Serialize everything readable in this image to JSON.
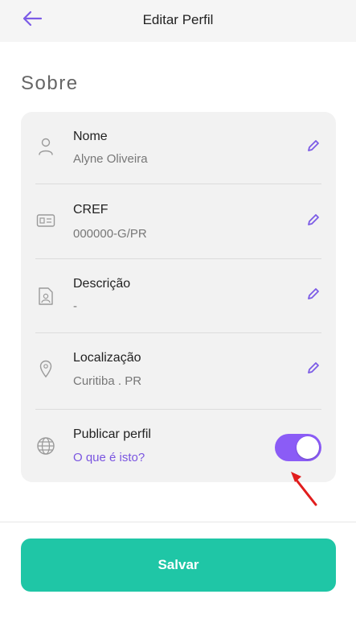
{
  "header": {
    "title": "Editar Perfil",
    "back_icon": "arrow-left-icon"
  },
  "section": {
    "title": "Sobre"
  },
  "fields": [
    {
      "label": "Nome",
      "value": "Alyne Oliveira",
      "icon": "user-icon"
    },
    {
      "label": "CREF",
      "value": "000000-G/PR",
      "icon": "id-card-icon"
    },
    {
      "label": "Descrição",
      "value": "-",
      "icon": "profile-document-icon"
    },
    {
      "label": "Localização",
      "value": "Curitiba . PR",
      "icon": "location-pin-icon"
    }
  ],
  "publish": {
    "label": "Publicar perfil",
    "help_link": "O que é isto?",
    "enabled": true,
    "icon": "globe-icon"
  },
  "footer": {
    "save_label": "Salvar"
  },
  "colors": {
    "accent": "#8b5cf6",
    "primary_button": "#1fc6a6",
    "annotation_arrow": "#e11d1d"
  }
}
